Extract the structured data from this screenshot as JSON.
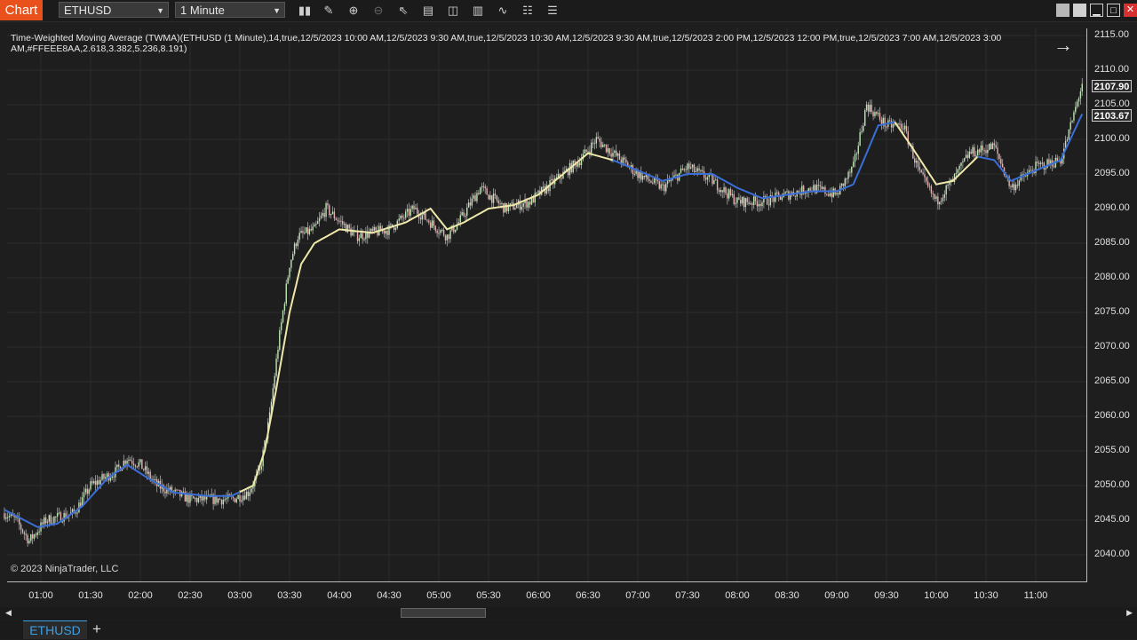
{
  "app": {
    "title": "Chart"
  },
  "toolbar": {
    "instrument": "ETHUSD",
    "interval": "1 Minute",
    "tools": [
      {
        "name": "bars-type-icon",
        "glyph": "▮▮"
      },
      {
        "name": "drawing-tools-icon",
        "glyph": "✎"
      },
      {
        "name": "zoom-in-icon",
        "glyph": "⊕"
      },
      {
        "name": "zoom-out-icon",
        "glyph": "⊖"
      },
      {
        "name": "pointer-icon",
        "glyph": "⇖"
      },
      {
        "name": "data-box-icon",
        "glyph": "▤"
      },
      {
        "name": "templates-icon",
        "glyph": "◫"
      },
      {
        "name": "strategies-icon",
        "glyph": "▥"
      },
      {
        "name": "indicators-icon",
        "glyph": "∿"
      },
      {
        "name": "properties-icon",
        "glyph": "☷"
      },
      {
        "name": "menu-icon",
        "glyph": "☰"
      }
    ]
  },
  "window_controls": {
    "tile_glyph": "",
    "minimize_glyph": "▁",
    "maximize_glyph": "□",
    "close_glyph": "✕"
  },
  "indicator_label": "Time-Weighted Moving Average (TWMA)(ETHUSD (1 Minute),14,true,12/5/2023 10:00 AM,12/5/2023 9:30 AM,true,12/5/2023 10:30 AM,12/5/2023 9:30 AM,true,12/5/2023 2:00 PM,12/5/2023 12:00 PM,true,12/5/2023 7:00 AM,12/5/2023 3:00 AM,#FFEEE8AA,2.618,3.382,5.236,8.191)",
  "copyright": "© 2023 NinjaTrader, LLC",
  "nav_arrow": "→",
  "colors": {
    "up": "#b9e6b0",
    "down": "#e8b0b0",
    "twma_rising": "#3a6fd8",
    "twma_falling": "#eee8aa"
  },
  "chart_data": {
    "type": "candlestick",
    "y_axis": {
      "min": 2040,
      "max": 2115,
      "step": 5,
      "ticks": [
        "2040.00",
        "2045.00",
        "2050.00",
        "2055.00",
        "2060.00",
        "2065.00",
        "2070.00",
        "2075.00",
        "2080.00",
        "2085.00",
        "2090.00",
        "2095.00",
        "2100.00",
        "2105.00",
        "2110.00",
        "2115.00"
      ]
    },
    "x_axis": {
      "ticks": [
        "01:00",
        "01:30",
        "02:00",
        "02:30",
        "03:00",
        "03:30",
        "04:00",
        "04:30",
        "05:00",
        "05:30",
        "06:00",
        "06:30",
        "07:00",
        "07:30",
        "08:00",
        "08:30",
        "09:00",
        "09:30",
        "10:00",
        "10:30",
        "11:00"
      ]
    },
    "price_path": [
      [
        "00:38",
        2046
      ],
      [
        "00:45",
        2045
      ],
      [
        "00:53",
        2042
      ],
      [
        "01:03",
        2045
      ],
      [
        "01:20",
        2046
      ],
      [
        "01:30",
        2050
      ],
      [
        "01:45",
        2052
      ],
      [
        "01:52",
        2054
      ],
      [
        "02:00",
        2053
      ],
      [
        "02:10",
        2050
      ],
      [
        "02:30",
        2048
      ],
      [
        "02:40",
        2048
      ],
      [
        "02:55",
        2048
      ],
      [
        "03:05",
        2049
      ],
      [
        "03:12",
        2052
      ],
      [
        "03:18",
        2060
      ],
      [
        "03:23",
        2070
      ],
      [
        "03:30",
        2082
      ],
      [
        "03:35",
        2086
      ],
      [
        "03:45",
        2087
      ],
      [
        "03:52",
        2090
      ],
      [
        "04:10",
        2086
      ],
      [
        "04:30",
        2087
      ],
      [
        "04:45",
        2090
      ],
      [
        "05:05",
        2086
      ],
      [
        "05:12",
        2088
      ],
      [
        "05:25",
        2093
      ],
      [
        "05:40",
        2090
      ],
      [
        "05:55",
        2091
      ],
      [
        "06:10",
        2094
      ],
      [
        "06:25",
        2097
      ],
      [
        "06:35",
        2100
      ],
      [
        "06:50",
        2097
      ],
      [
        "07:00",
        2095
      ],
      [
        "07:15",
        2093
      ],
      [
        "07:30",
        2096
      ],
      [
        "07:45",
        2094
      ],
      [
        "08:00",
        2091
      ],
      [
        "08:15",
        2091
      ],
      [
        "08:30",
        2092
      ],
      [
        "08:45",
        2093
      ],
      [
        "09:00",
        2092
      ],
      [
        "09:10",
        2096
      ],
      [
        "09:18",
        2105
      ],
      [
        "09:30",
        2102
      ],
      [
        "09:40",
        2102
      ],
      [
        "09:50",
        2095
      ],
      [
        "10:00",
        2091
      ],
      [
        "10:10",
        2094
      ],
      [
        "10:20",
        2098
      ],
      [
        "10:35",
        2099
      ],
      [
        "10:45",
        2093
      ],
      [
        "11:00",
        2096
      ],
      [
        "11:15",
        2097
      ],
      [
        "11:20",
        2101
      ],
      [
        "11:28",
        2108
      ]
    ],
    "twma_path": [
      [
        "00:38",
        2046.5
      ],
      [
        "00:50",
        2045
      ],
      [
        "00:58",
        2044
      ],
      [
        "01:10",
        2044.5
      ],
      [
        "01:25",
        2047
      ],
      [
        "01:40",
        2051
      ],
      [
        "01:52",
        2053
      ],
      [
        "02:05",
        2051
      ],
      [
        "02:20",
        2049
      ],
      [
        "02:40",
        2048.5
      ],
      [
        "02:55",
        2048.5
      ],
      [
        "03:08",
        2050
      ],
      [
        "03:15",
        2055
      ],
      [
        "03:22",
        2064
      ],
      [
        "03:30",
        2075
      ],
      [
        "03:37",
        2082
      ],
      [
        "03:45",
        2085
      ],
      [
        "04:00",
        2087
      ],
      [
        "04:20",
        2086.5
      ],
      [
        "04:40",
        2088
      ],
      [
        "04:55",
        2090
      ],
      [
        "05:05",
        2087
      ],
      [
        "05:15",
        2088
      ],
      [
        "05:30",
        2090
      ],
      [
        "05:45",
        2090.5
      ],
      [
        "06:00",
        2092
      ],
      [
        "06:15",
        2095
      ],
      [
        "06:30",
        2098
      ],
      [
        "06:45",
        2097
      ],
      [
        "07:00",
        2095.5
      ],
      [
        "07:15",
        2094
      ],
      [
        "07:30",
        2095
      ],
      [
        "07:45",
        2095
      ],
      [
        "08:00",
        2093
      ],
      [
        "08:15",
        2091.5
      ],
      [
        "08:30",
        2092
      ],
      [
        "08:45",
        2092.5
      ],
      [
        "09:00",
        2092.5
      ],
      [
        "09:10",
        2093.5
      ],
      [
        "09:18",
        2098
      ],
      [
        "09:25",
        2102
      ],
      [
        "09:35",
        2102.5
      ],
      [
        "09:45",
        2099
      ],
      [
        "10:00",
        2093.5
      ],
      [
        "10:10",
        2094
      ],
      [
        "10:25",
        2097.5
      ],
      [
        "10:35",
        2097
      ],
      [
        "10:45",
        2094
      ],
      [
        "11:00",
        2095.5
      ],
      [
        "11:15",
        2097
      ],
      [
        "11:28",
        2103.67
      ]
    ],
    "twma_color_segments": [
      {
        "from": "00:38",
        "to": "03:00",
        "color": "rising"
      },
      {
        "from": "03:00",
        "to": "06:45",
        "color": "falling"
      },
      {
        "from": "06:45",
        "to": "09:10",
        "color": "rising"
      },
      {
        "from": "09:10",
        "to": "09:35",
        "color": "rising"
      },
      {
        "from": "09:35",
        "to": "10:25",
        "color": "falling"
      },
      {
        "from": "10:25",
        "to": "11:28",
        "color": "rising"
      }
    ],
    "last_price": "2107.90",
    "twma_last": "2103.67"
  },
  "tabs": [
    {
      "label": "ETHUSD"
    }
  ],
  "add_tab": "+"
}
